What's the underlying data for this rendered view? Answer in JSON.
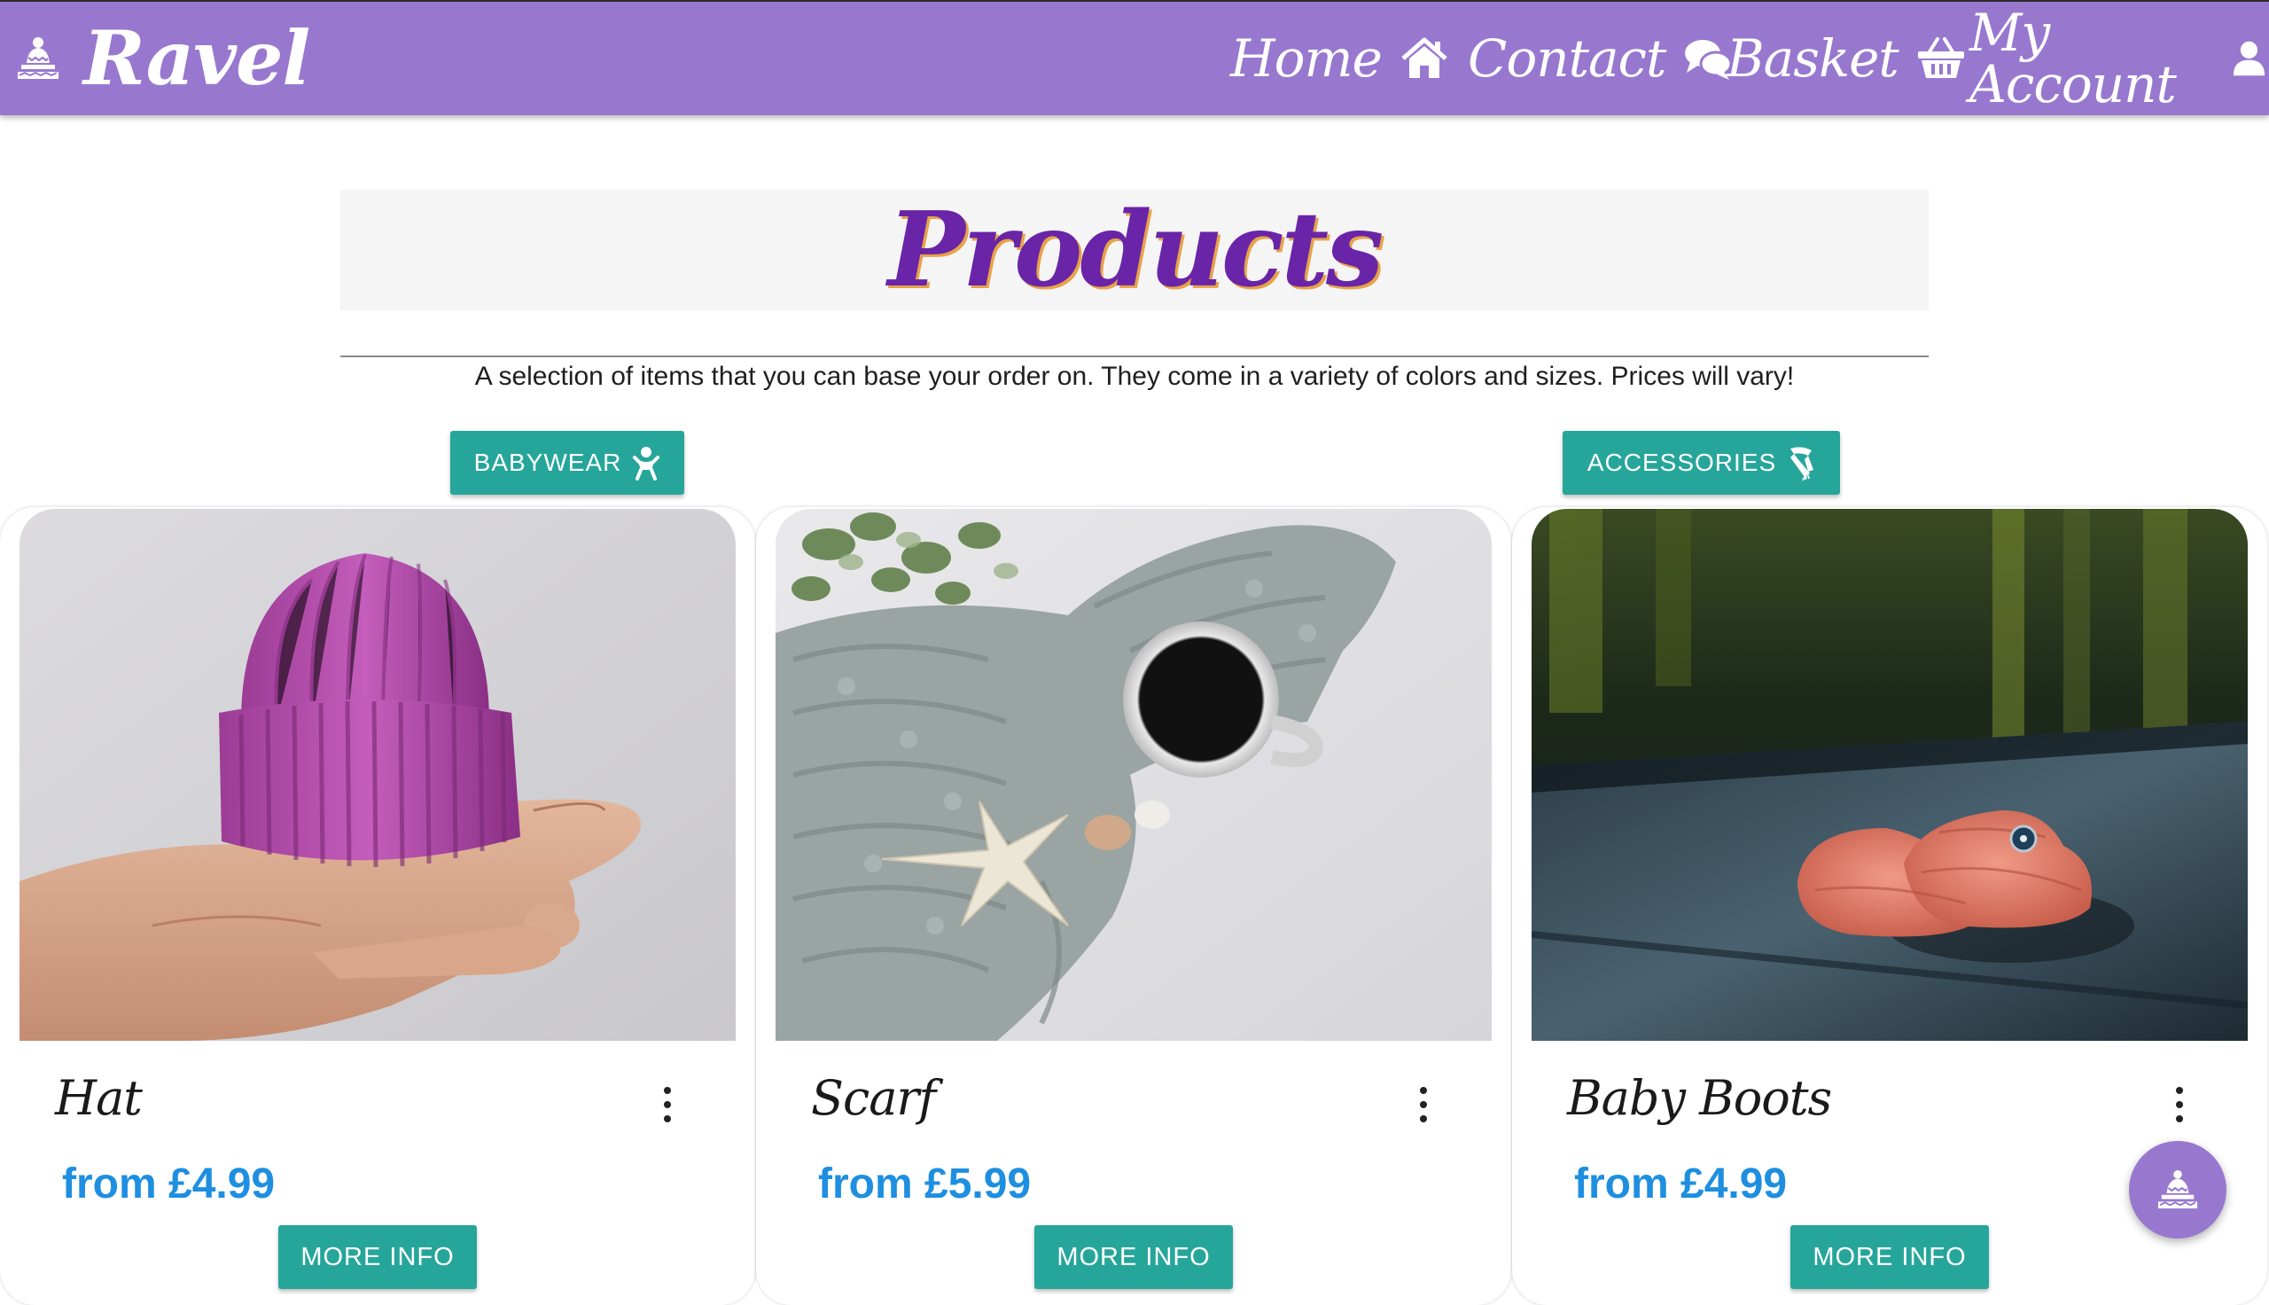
{
  "navbar": {
    "brand": "Ravel",
    "brand_icon": "knitted-hat-icon",
    "items": [
      {
        "label": "Home",
        "icon": "home-icon"
      },
      {
        "label": "Contact",
        "icon": "chat-icon"
      },
      {
        "label": "Basket",
        "icon": "basket-icon"
      },
      {
        "label": "My Account",
        "icon": "user-icon"
      }
    ]
  },
  "header": {
    "title": "Products",
    "subtitle": "A selection of items that you can base your order on. They come in a variety of colors and sizes. Prices will vary!"
  },
  "categories": [
    {
      "label": "BABYWEAR",
      "icon": "baby-icon"
    },
    {
      "label": "ACCESSORIES",
      "icon": "scarf-icon"
    }
  ],
  "products": [
    {
      "name": "Hat",
      "price": "from £4.99",
      "button": "MORE INFO",
      "image": "pink knitted hat held in a hand"
    },
    {
      "name": "Scarf",
      "price": "from £5.99",
      "button": "MORE INFO",
      "image": "grey chunky knit scarf with coffee cup and starfish"
    },
    {
      "name": "Baby Boots",
      "price": "from £4.99",
      "button": "MORE INFO",
      "image": "coral crocheted baby booties on dark wood"
    }
  ],
  "fab": {
    "icon": "knitted-hat-icon"
  },
  "colors": {
    "navbar": "#9878cf",
    "title": "#6a24a8",
    "title_shadow": "#e8a24a",
    "button": "#26a69a",
    "price": "#1e8fe0",
    "title_box": "#f5f5f5"
  }
}
